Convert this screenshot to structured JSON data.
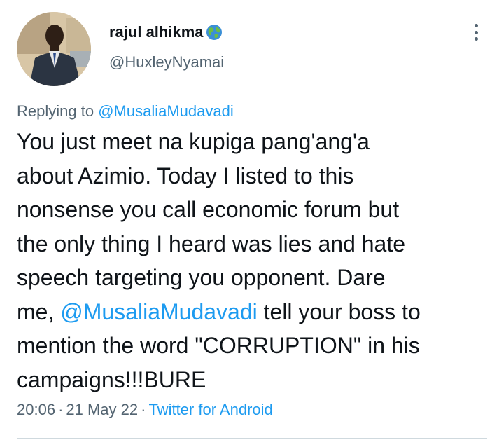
{
  "author": {
    "display_name": "rajul alhikma",
    "name_emoji": "globe-icon",
    "handle": "@HuxleyNyamai"
  },
  "reply": {
    "prefix": "Replying to ",
    "mention": "@MusaliaMudavadi"
  },
  "tweet": {
    "line1": "You just meet na kupiga pang'ang'a",
    "line2": "about Azimio. Today I listed to this",
    "line3": "nonsense you call economic forum but",
    "line4": "the only thing I heard was lies and hate",
    "line5": "speech targeting you opponent. Dare",
    "line6_pre": "me, ",
    "line6_mention": "@MusaliaMudavadi",
    "line6_post": " tell your boss to",
    "line7": "mention the word \"CORRUPTION\" in his",
    "line8": "campaigns!!!BURE"
  },
  "meta": {
    "time": "20:06",
    "separator": "·",
    "date": "21 May 22",
    "source": "Twitter for Android"
  },
  "colors": {
    "link": "#1d9bf0",
    "secondary_text": "#536471",
    "primary_text": "#0f1419",
    "divider": "#cfd9de"
  }
}
